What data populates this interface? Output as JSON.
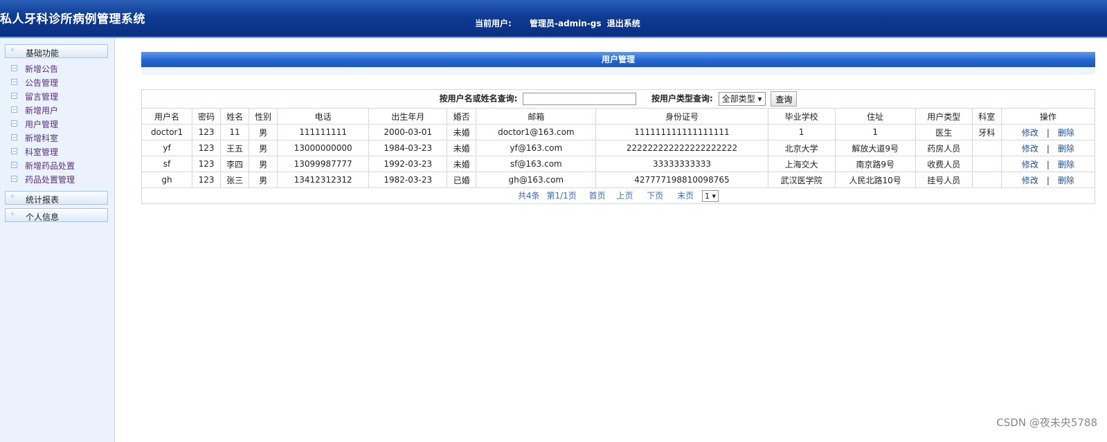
{
  "header": {
    "app_title": "私人牙科诊所病例管理系统",
    "current_user_label": "当前用户:",
    "current_user": "管理员-admin-gs",
    "logout": "退出系统"
  },
  "sidebar": {
    "groups": [
      {
        "label": "基础功能"
      },
      {
        "label": "统计报表"
      },
      {
        "label": "个人信息"
      }
    ],
    "items": [
      {
        "label": "新增公告"
      },
      {
        "label": "公告管理"
      },
      {
        "label": "留言管理"
      },
      {
        "label": "新增用户"
      },
      {
        "label": "用户管理"
      },
      {
        "label": "新增科室"
      },
      {
        "label": "科室管理"
      },
      {
        "label": "新增药品处置"
      },
      {
        "label": "药品处置管理"
      }
    ]
  },
  "main": {
    "title": "用户管理",
    "search": {
      "name_label": "按用户名或姓名查询:",
      "name_value": "",
      "type_label": "按用户类型查询:",
      "type_value": "全部类型",
      "query_button": "查询"
    },
    "columns": [
      "用户名",
      "密码",
      "姓名",
      "性别",
      "电话",
      "出生年月",
      "婚否",
      "邮箱",
      "身份证号",
      "毕业学校",
      "住址",
      "用户类型",
      "科室",
      "操作"
    ],
    "rows": [
      [
        "doctor1",
        "123",
        "11",
        "男",
        "111111111",
        "2000-03-01",
        "未婚",
        "doctor1@163.com",
        "111111111111111111",
        "1",
        "1",
        "医生",
        "牙科"
      ],
      [
        "yf",
        "123",
        "王五",
        "男",
        "13000000000",
        "1984-03-23",
        "未婚",
        "yf@163.com",
        "222222222222222222222",
        "北京大学",
        "解放大道9号",
        "药房人员",
        ""
      ],
      [
        "sf",
        "123",
        "李四",
        "男",
        "13099987777",
        "1992-03-23",
        "未婚",
        "sf@163.com",
        "33333333333",
        "上海交大",
        "南京路9号",
        "收费人员",
        ""
      ],
      [
        "gh",
        "123",
        "张三",
        "男",
        "13412312312",
        "1982-03-23",
        "已婚",
        "gh@163.com",
        "427777198810098765",
        "武汉医学院",
        "人民北路10号",
        "挂号人员",
        ""
      ]
    ],
    "actions": {
      "edit": "修改",
      "separator": "|",
      "delete": "删除"
    },
    "pager": {
      "total": "共4条",
      "page": "第1/1页",
      "first": "首页",
      "prev": "上页",
      "next": "下页",
      "last": "末页",
      "current_page": "1"
    }
  },
  "watermark": "CSDN @夜未央5788",
  "colors": {
    "header_bg": "#0e3b93",
    "panel_title_bg": "#2467d2",
    "sidebar_bg": "#eaf3fb",
    "menu_text": "#5a2f7f",
    "link": "#1f4e9b"
  }
}
